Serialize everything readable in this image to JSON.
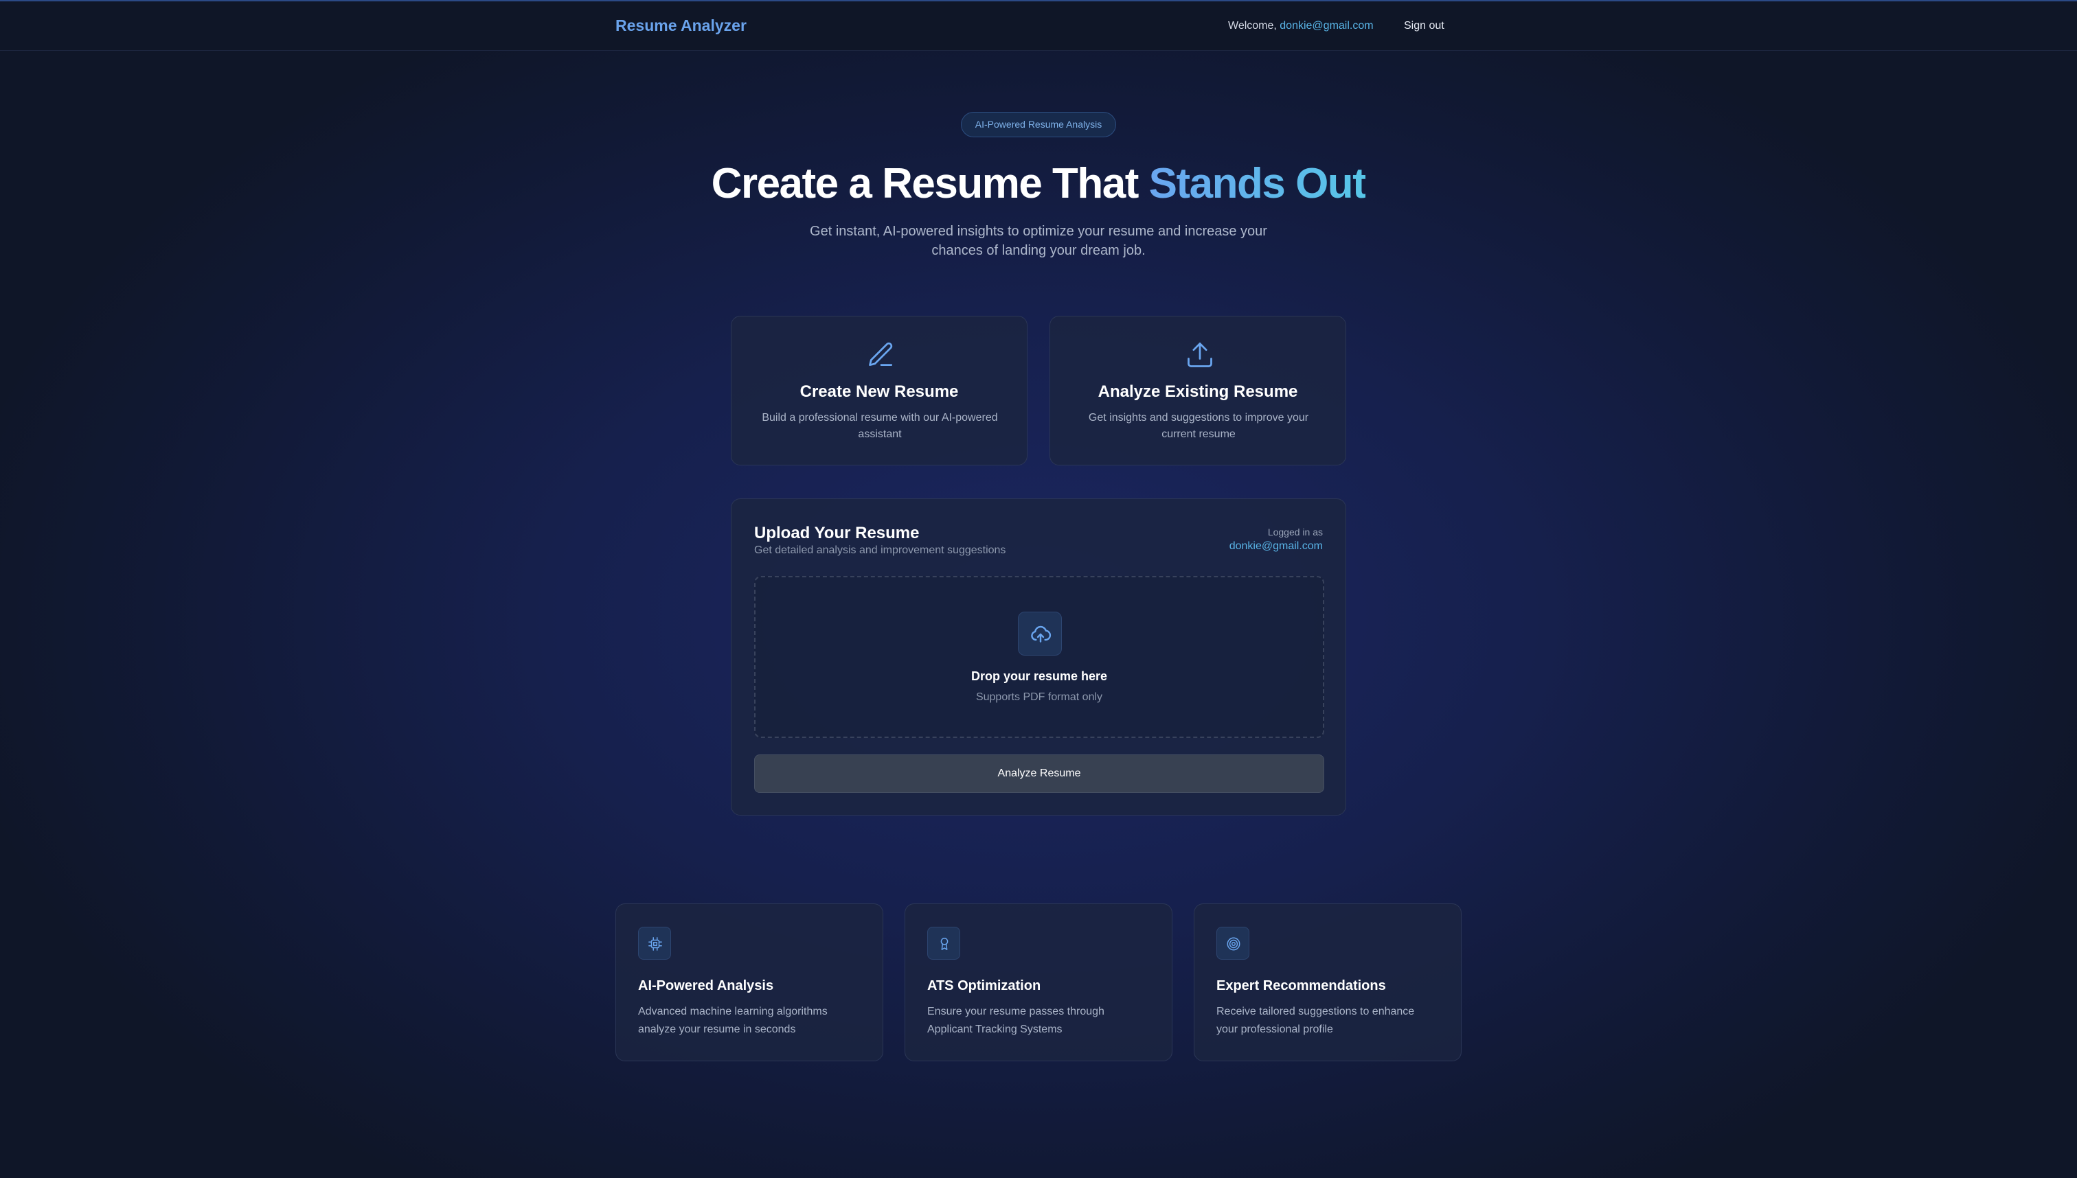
{
  "nav": {
    "brand": "Resume Analyzer",
    "welcome_prefix": "Welcome, ",
    "user_email": "donkie@gmail.com",
    "sign_out": "Sign out"
  },
  "hero": {
    "badge": "AI-Powered Resume Analysis",
    "title_main": "Create a Resume That ",
    "title_accent": "Stands Out",
    "subtitle": "Get instant, AI-powered insights to optimize your resume and increase your chances of landing your dream job."
  },
  "options": [
    {
      "icon": "pencil-icon",
      "title": "Create New Resume",
      "description": "Build a professional resume with our AI-powered assistant"
    },
    {
      "icon": "upload-icon",
      "title": "Analyze Existing Resume",
      "description": "Get insights and suggestions to improve your current resume"
    }
  ],
  "upload": {
    "title": "Upload Your Resume",
    "subtitle": "Get detailed analysis and improvement suggestions",
    "logged_in_label": "Logged in as",
    "logged_in_email": "donkie@gmail.com",
    "drop_title": "Drop your resume here",
    "drop_subtitle": "Supports PDF format only",
    "button_label": "Analyze Resume"
  },
  "features": [
    {
      "icon": "cpu-chip-icon",
      "title": "AI-Powered Analysis",
      "description": "Advanced machine learning algorithms analyze your resume in seconds"
    },
    {
      "icon": "award-ribbon-icon",
      "title": "ATS Optimization",
      "description": "Ensure your resume passes through Applicant Tracking Systems"
    },
    {
      "icon": "target-icon",
      "title": "Expert Recommendations",
      "description": "Receive tailored suggestions to enhance your professional profile"
    }
  ],
  "colors": {
    "accent_blue": "#6aa6f0",
    "accent_cyan": "#57c6e8",
    "background": "#16204d",
    "card": "#1b2541"
  }
}
